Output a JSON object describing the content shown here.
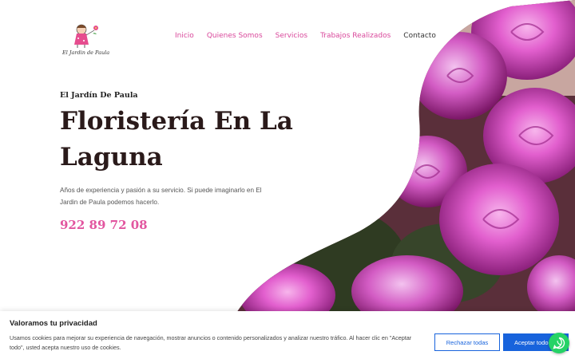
{
  "header": {
    "logo_text": "El Jardin de Paula",
    "nav": [
      {
        "label": "Inicio"
      },
      {
        "label": "Quienes Somos"
      },
      {
        "label": "Servicios"
      },
      {
        "label": "Trabajos Realizados"
      },
      {
        "label": "Contacto"
      }
    ]
  },
  "hero": {
    "eyebrow": "El Jardín De Paula",
    "title": "Floristería En La Laguna",
    "description": "Años de experiencia y pasión a su servicio. Si puede imaginarlo en El Jardin de Paula podemos hacerlo.",
    "phone": "922 89 72 08",
    "image_icon": "roses-photo"
  },
  "cookie_banner": {
    "title": "Valoramos tu privacidad",
    "text": "Usamos cookies para mejorar su experiencia de navegación, mostrar anuncios o contenido personalizados y analizar nuestro tráfico. Al hacer clic en \"Aceptar todo\", usted acepta nuestro uso de cookies.",
    "reject_label": "Rechazar todas",
    "accept_label": "Aceptar todo"
  },
  "colors": {
    "brand_pink": "#d9489b",
    "cookie_blue": "#1863dc",
    "whatsapp_green": "#25d366"
  }
}
